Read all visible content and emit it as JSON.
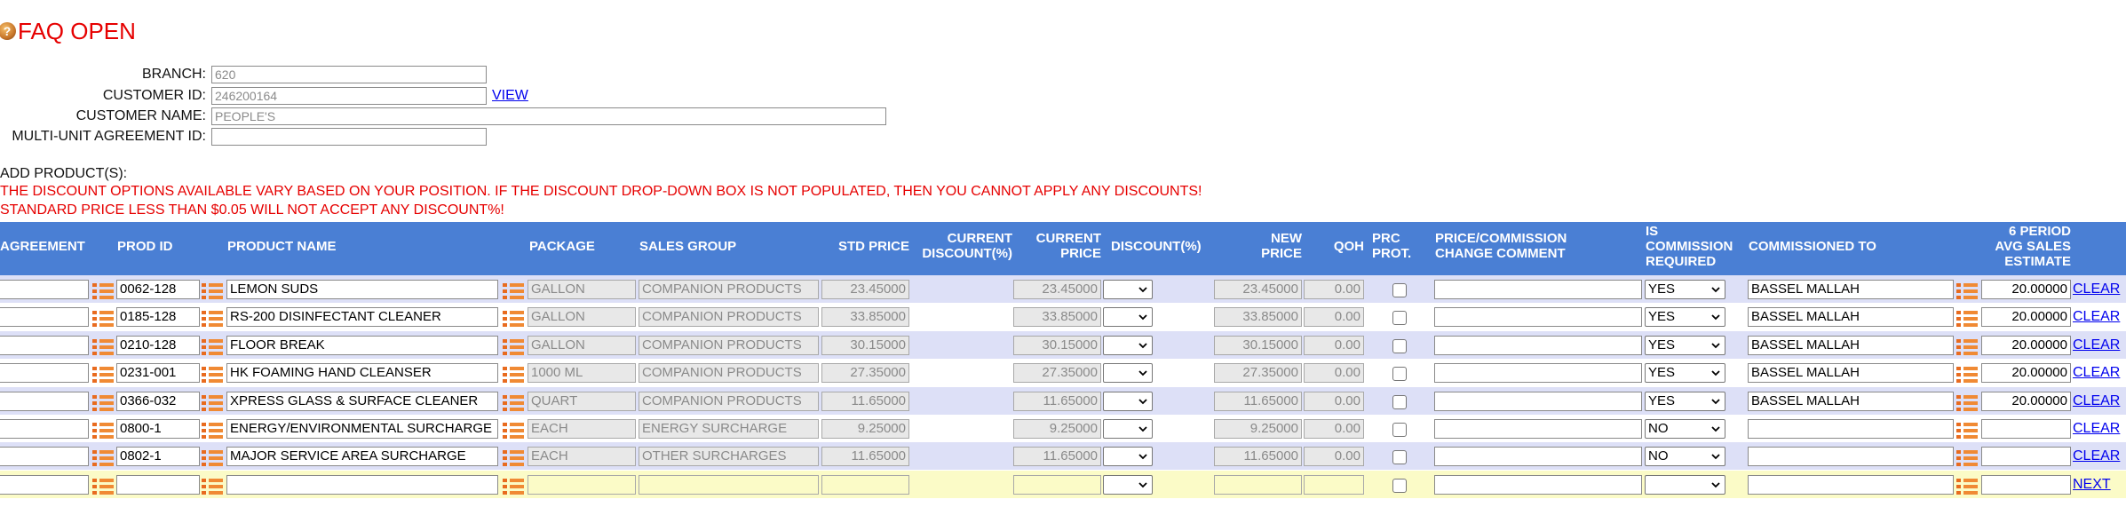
{
  "page": {
    "title": "FAQ OPEN",
    "icon": "faq-help-icon",
    "accent_color": "#e60000",
    "header_color": "#4a7fd4"
  },
  "form": {
    "branch": {
      "label": "BRANCH:",
      "value": "620"
    },
    "customer_id": {
      "label": "CUSTOMER ID:",
      "value": "246200164",
      "link": "VIEW"
    },
    "customer_name": {
      "label": "CUSTOMER NAME:",
      "value": "PEOPLE'S"
    },
    "multi_unit": {
      "label": "MULTI-UNIT AGREEMENT ID:",
      "value": ""
    }
  },
  "add_products_label": "ADD PRODUCT(S):",
  "warnings": [
    "THE DISCOUNT OPTIONS AVAILABLE VARY BASED ON YOUR POSITION. IF THE DISCOUNT DROP-DOWN BOX IS NOT POPULATED, THEN YOU CANNOT APPLY ANY DISCOUNTS!",
    "STANDARD PRICE LESS THAN $0.05 WILL NOT ACCEPT ANY DISCOUNT%!"
  ],
  "columns": {
    "agreement": "AGREEMENT",
    "prod_id": "PROD ID",
    "product_name": "PRODUCT NAME",
    "package": "PACKAGE",
    "sales_group": "SALES GROUP",
    "std_price": "STD PRICE",
    "current_discount_1": "CURRENT",
    "current_discount_2": "DISCOUNT(%)",
    "current_price_1": "CURRENT",
    "current_price_2": "PRICE",
    "discount": "DISCOUNT(%)",
    "new_price_1": "NEW",
    "new_price_2": "PRICE",
    "qoh": "QOH",
    "prc_prot_1": "PRC",
    "prc_prot_2": "PROT.",
    "comment_1": "PRICE/COMMISSION",
    "comment_2": "CHANGE COMMENT",
    "commission_1": "IS",
    "commission_2": "COMMISSION",
    "commission_3": "REQUIRED",
    "commissioned_to": "COMMISSIONED TO",
    "estimate_1": "6 PERIOD",
    "estimate_2": "AVG SALES",
    "estimate_3": "ESTIMATE"
  },
  "rows": [
    {
      "prod_id": "0062-128",
      "product_name": "LEMON SUDS",
      "package": "GALLON",
      "sales_group": "COMPANION PRODUCTS",
      "std_price": "23.45000",
      "current_price": "23.45000",
      "new_price": "23.45000",
      "qoh": "0.00",
      "commission_required": "YES",
      "commissioned_to": "BASSEL MALLAH",
      "estimate": "20.00000",
      "action": "CLEAR"
    },
    {
      "prod_id": "0185-128",
      "product_name": "RS-200 DISINFECTANT CLEANER",
      "package": "GALLON",
      "sales_group": "COMPANION PRODUCTS",
      "std_price": "33.85000",
      "current_price": "33.85000",
      "new_price": "33.85000",
      "qoh": "0.00",
      "commission_required": "YES",
      "commissioned_to": "BASSEL MALLAH",
      "estimate": "20.00000",
      "action": "CLEAR"
    },
    {
      "prod_id": "0210-128",
      "product_name": "FLOOR BREAK",
      "package": "GALLON",
      "sales_group": "COMPANION PRODUCTS",
      "std_price": "30.15000",
      "current_price": "30.15000",
      "new_price": "30.15000",
      "qoh": "0.00",
      "commission_required": "YES",
      "commissioned_to": "BASSEL MALLAH",
      "estimate": "20.00000",
      "action": "CLEAR"
    },
    {
      "prod_id": "0231-001",
      "product_name": "HK FOAMING HAND CLEANSER",
      "package": "1000 ML",
      "sales_group": "COMPANION PRODUCTS",
      "std_price": "27.35000",
      "current_price": "27.35000",
      "new_price": "27.35000",
      "qoh": "0.00",
      "commission_required": "YES",
      "commissioned_to": "BASSEL MALLAH",
      "estimate": "20.00000",
      "action": "CLEAR"
    },
    {
      "prod_id": "0366-032",
      "product_name": "XPRESS GLASS & SURFACE CLEANER",
      "package": "QUART",
      "sales_group": "COMPANION PRODUCTS",
      "std_price": "11.65000",
      "current_price": "11.65000",
      "new_price": "11.65000",
      "qoh": "0.00",
      "commission_required": "YES",
      "commissioned_to": "BASSEL MALLAH",
      "estimate": "20.00000",
      "action": "CLEAR"
    },
    {
      "prod_id": "0800-1",
      "product_name": "ENERGY/ENVIRONMENTAL SURCHARGE",
      "package": "EACH",
      "sales_group": "ENERGY SURCHARGE",
      "std_price": "9.25000",
      "current_price": "9.25000",
      "new_price": "9.25000",
      "qoh": "0.00",
      "commission_required": "NO",
      "commissioned_to": "",
      "estimate": "",
      "action": "CLEAR"
    },
    {
      "prod_id": "0802-1",
      "product_name": "MAJOR SERVICE AREA SURCHARGE",
      "package": "EACH",
      "sales_group": "OTHER SURCHARGES",
      "std_price": "11.65000",
      "current_price": "11.65000",
      "new_price": "11.65000",
      "qoh": "0.00",
      "commission_required": "NO",
      "commissioned_to": "",
      "estimate": "",
      "action": "CLEAR"
    }
  ],
  "new_row": {
    "action": "NEXT"
  }
}
